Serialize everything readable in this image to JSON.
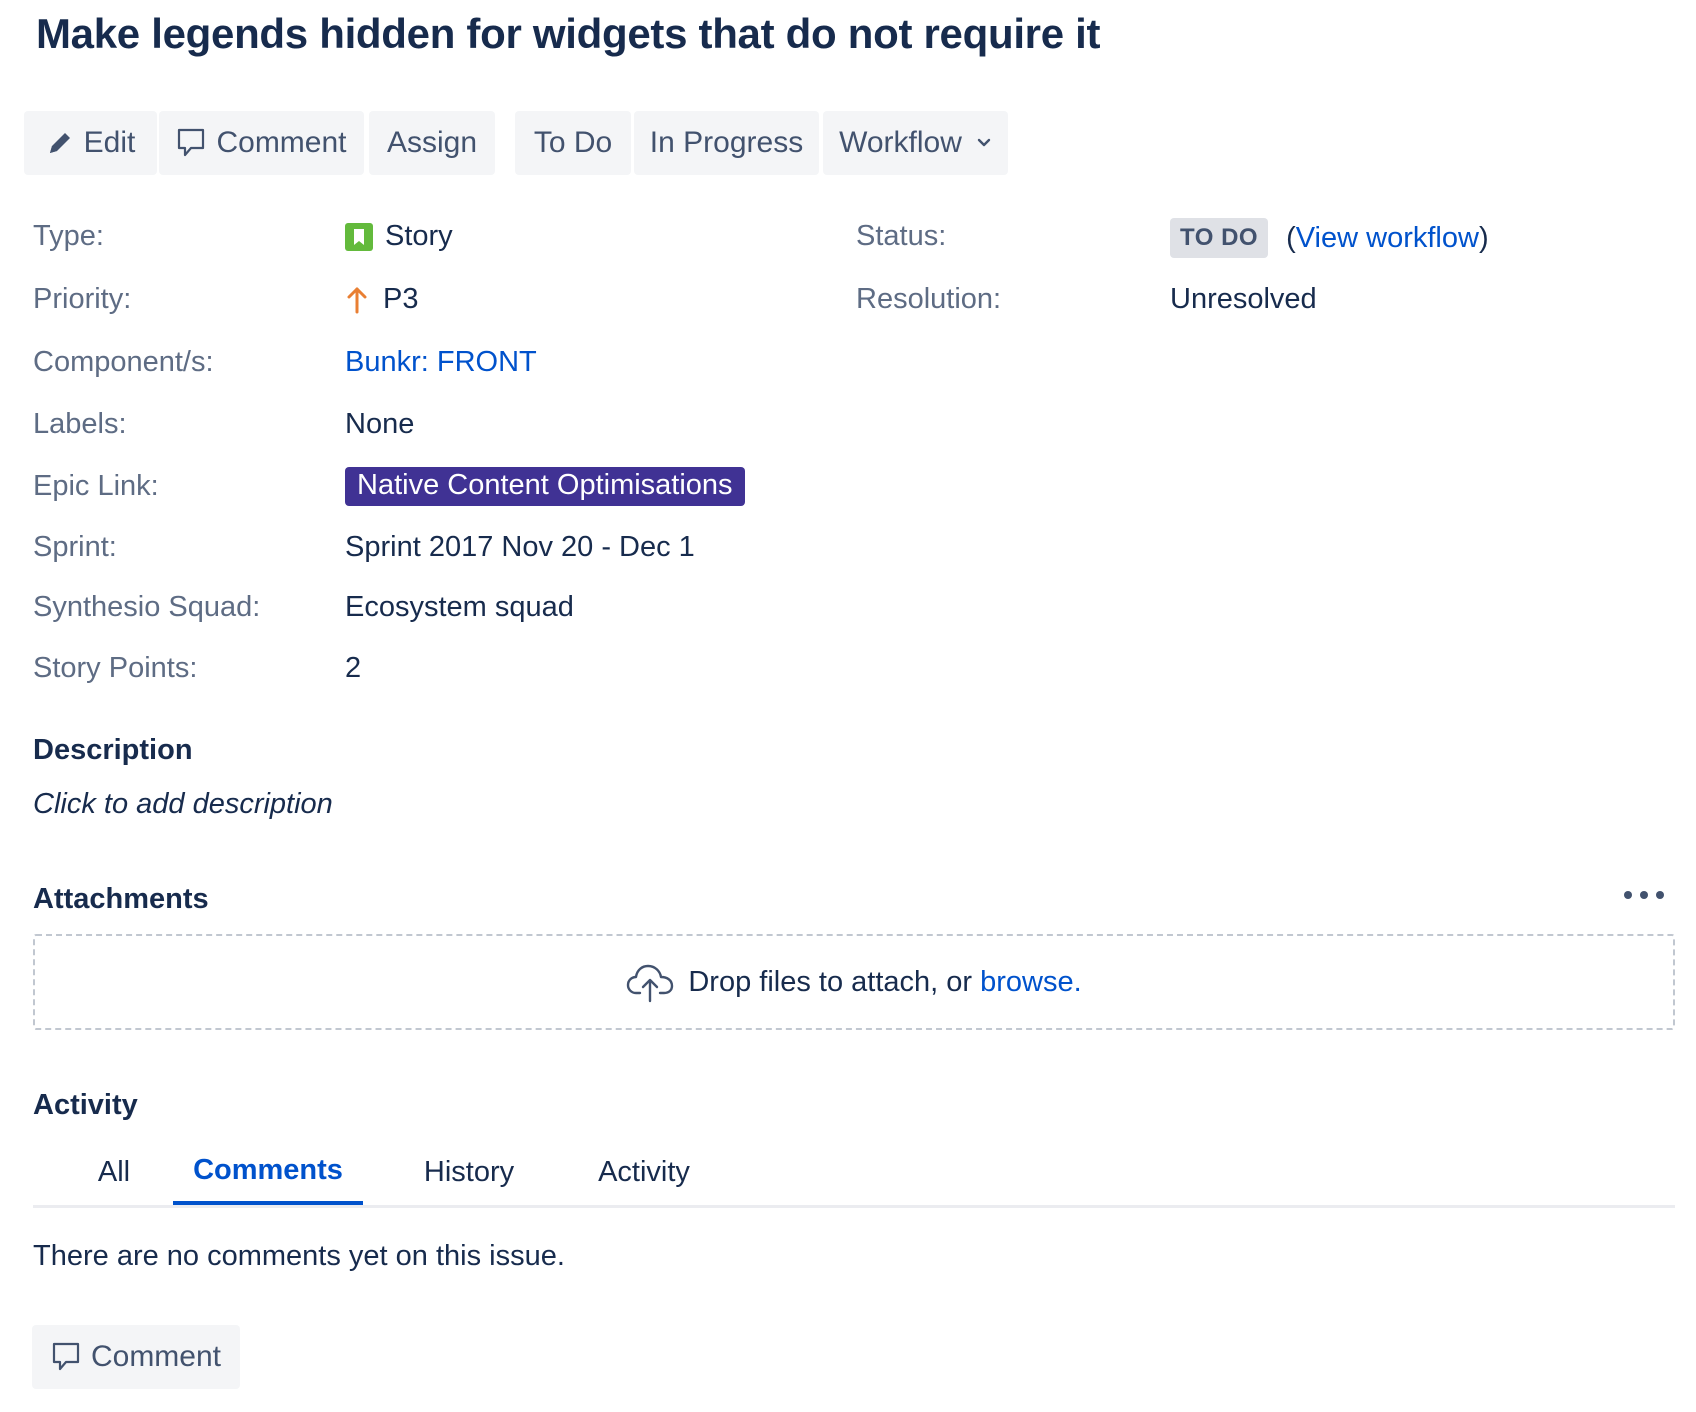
{
  "issue": {
    "title": "Make legends hidden for widgets that do not require it"
  },
  "toolbar": {
    "edit_label": "Edit",
    "comment_label": "Comment",
    "assign_label": "Assign",
    "todo_label": "To Do",
    "in_progress_label": "In Progress",
    "workflow_label": "Workflow"
  },
  "fields": {
    "type": {
      "label": "Type:",
      "value": "Story",
      "icon": "story-icon"
    },
    "priority": {
      "label": "Priority:",
      "value": "P3",
      "icon": "arrow-up-icon"
    },
    "components": {
      "label": "Component/s:",
      "value": "Bunkr: FRONT"
    },
    "labels": {
      "label": "Labels:",
      "value": "None"
    },
    "epic_link": {
      "label": "Epic Link:",
      "value": "Native Content Optimisations"
    },
    "sprint": {
      "label": "Sprint:",
      "value": "Sprint 2017 Nov 20 - Dec 1"
    },
    "squad": {
      "label": "Synthesio Squad:",
      "value": "Ecosystem squad"
    },
    "story_points": {
      "label": "Story Points:",
      "value": "2"
    },
    "status": {
      "label": "Status:",
      "value": "TO DO",
      "view_workflow_open": "(",
      "view_workflow_link": "View workflow",
      "view_workflow_close": ")"
    },
    "resolution": {
      "label": "Resolution:",
      "value": "Unresolved"
    }
  },
  "description": {
    "title": "Description",
    "placeholder": "Click to add description"
  },
  "attachments": {
    "title": "Attachments",
    "drop_text": "Drop files to attach, or ",
    "browse_link": "browse."
  },
  "activity": {
    "title": "Activity",
    "tabs": [
      "All",
      "Comments",
      "History",
      "Activity"
    ],
    "active_tab": "Comments",
    "empty_text": "There are no comments yet on this issue.",
    "comment_button": "Comment"
  },
  "colors": {
    "text": "#172b4d",
    "muted": "#5e6c84",
    "link": "#0052cc",
    "epic": "#403294",
    "button_bg": "#f4f5f7",
    "story_green": "#63ba3c",
    "priority_orange": "#e97f33"
  }
}
